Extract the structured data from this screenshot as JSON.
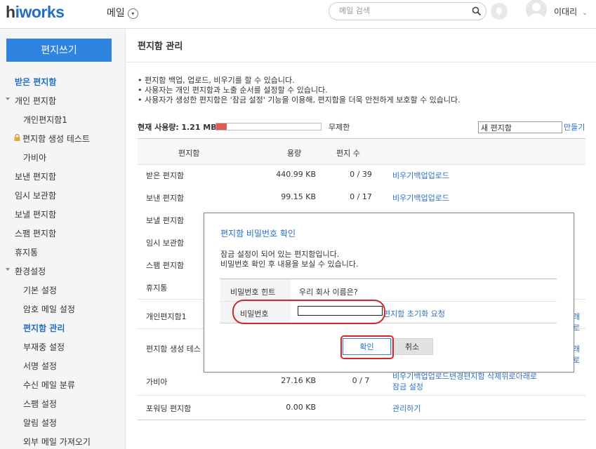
{
  "header": {
    "logo": "hiworks",
    "menu_label": "메일",
    "search_placeholder": "메일 검색",
    "user_name": "이대리"
  },
  "sidebar": {
    "compose_label": "편지쓰기",
    "items": [
      {
        "label": "받은 편지함",
        "active": true
      },
      {
        "label": "개인 편지함",
        "collapsible": true
      },
      {
        "label": "개인편지함1"
      },
      {
        "label": "편지함 생성 테스트",
        "locked": true
      },
      {
        "label": "가비아"
      },
      {
        "label": "보낸 편지함"
      },
      {
        "label": "임시 보관함"
      },
      {
        "label": "보낼 편지함"
      },
      {
        "label": "스팸 편지함"
      },
      {
        "label": "휴지통"
      },
      {
        "label": "환경설정",
        "collapsible": true
      },
      {
        "label": "기본 설정"
      },
      {
        "label": "암호 메일 설정"
      },
      {
        "label": "편지함 관리",
        "active": true
      },
      {
        "label": "부재중 설정"
      },
      {
        "label": "서명 설정"
      },
      {
        "label": "수신 메일 분류"
      },
      {
        "label": "스팸 설정"
      },
      {
        "label": "알림 설정"
      },
      {
        "label": "외부 메일 가져오기"
      }
    ]
  },
  "main": {
    "title": "편지함 관리",
    "notes": [
      "• 편지함 백업, 업로드, 비우기를 할 수 있습니다.",
      "• 사용자는 개인 편지함과 노출 순서를 설정할 수 있습니다.",
      "• 사용자가 생성한 편지함은 '잠금 설정' 기능을 이용해, 편지함을 더욱 안전하게 보호할 수 있습니다."
    ],
    "usage_label": "현재 사용량:",
    "usage_value": "1.21 MB",
    "usage_fraction": 0.1,
    "quota_label": "무제한",
    "new_box_value": "새 편지함",
    "create_label": "만들기",
    "columns": {
      "name": "편지함",
      "size": "용량",
      "count": "편지 수"
    },
    "rows": [
      {
        "name": "받은 편지함",
        "size": "440.99 KB",
        "count": "0 / 39",
        "actions": [
          "비우기",
          "백업",
          "업로드"
        ]
      },
      {
        "name": "보낸 편지함",
        "size": "99.15 KB",
        "count": "0 / 17",
        "actions": [
          "비우기",
          "백업",
          "업로드"
        ]
      },
      {
        "name": "보낼 편지함"
      },
      {
        "name": "임시 보관함"
      },
      {
        "name": "스팸 편지함"
      },
      {
        "name": "휴지통"
      },
      {
        "name": "개인편지함1",
        "tail": "래로"
      },
      {
        "name": "편지함 생성 테스",
        "tail": "래로"
      },
      {
        "name": "가비아",
        "size": "27.16 KB",
        "count": "0 / 7",
        "actions": [
          "비우기",
          "백업",
          "업로드",
          "변경",
          "편지함 삭제",
          "위로",
          "아래로"
        ],
        "actions2": [
          "잠금 설정"
        ]
      },
      {
        "name": "포워딩 편지함",
        "size": "0.00 KB",
        "actions": [
          "관리하기"
        ]
      }
    ]
  },
  "modal": {
    "title": "편지함 비밀번호 확인",
    "desc_line1": "잠금 설정이 되어 있는 편지함입니다.",
    "desc_line2": "비밀번호 확인 후 내용을 보실 수 있습니다.",
    "hint_label": "비밀번호 힌트",
    "hint_value": "우리 회사 이름은?",
    "password_label": "비밀번호",
    "password_value": "",
    "reset_link": "편지함 초기화 요청",
    "ok_label": "확인",
    "cancel_label": "취소"
  },
  "colors": {
    "accent": "#2f84df",
    "link": "#2f72c4",
    "highlight_ring": "#d42828",
    "usage_bar": "#e05a5a"
  }
}
